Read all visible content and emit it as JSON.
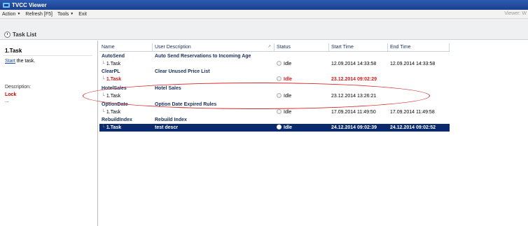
{
  "window": {
    "title": "TVCC Viewer"
  },
  "menu": [
    {
      "label": "Action",
      "has_caret": true
    },
    {
      "label": "Refresh [F5]",
      "has_caret": false
    },
    {
      "label": "Tools",
      "has_caret": true
    },
    {
      "label": "Exit",
      "has_caret": false
    }
  ],
  "viewer_label": "Viewer: W",
  "section_title": "Task List",
  "left_panel": {
    "task_name": "1.Task",
    "start_link": "Start",
    "start_rest": " the task.",
    "description_label": "Description:",
    "lock_label": "Lock",
    "ellipsis": "..."
  },
  "columns": [
    "Name",
    "User Description",
    "Status",
    "Start Time",
    "End Time"
  ],
  "rows": [
    {
      "type": "group",
      "name": "AutoSend",
      "description": "Auto Send Reservations to Incoming Age",
      "status": "",
      "start": "",
      "end": ""
    },
    {
      "type": "task",
      "name": "1.Task",
      "description": "",
      "status": "Idle",
      "start": "12.09.2014 14:33:58",
      "end": "12.09.2014 14:33:58"
    },
    {
      "type": "group",
      "name": "ClearPL",
      "description": "Clear Unused Price List",
      "status": "",
      "start": "",
      "end": ""
    },
    {
      "type": "task-red",
      "name": "1.Task",
      "description": "",
      "status": "Idle",
      "start": "23.12.2014 09:02:29",
      "end": ""
    },
    {
      "type": "group",
      "name": "HotelSales",
      "description": "Hotel Sales",
      "status": "",
      "start": "",
      "end": ""
    },
    {
      "type": "task",
      "name": "1.Task",
      "description": "",
      "status": "Idle",
      "start": "23.12.2014 13:26:21",
      "end": ""
    },
    {
      "type": "group",
      "name": "OptionDate",
      "description": "Option Date Expired Rules",
      "status": "",
      "start": "",
      "end": ""
    },
    {
      "type": "task",
      "name": "1.Task",
      "description": "",
      "status": "Idle",
      "start": "17.09.2014 11:49:50",
      "end": "17.09.2014 11:49:58"
    },
    {
      "type": "group",
      "name": "RebuildIndex",
      "description": "Rebuild Index",
      "status": "",
      "start": "",
      "end": ""
    },
    {
      "type": "task-selected",
      "name": "1.Task",
      "description": "test descr",
      "status": "Idle",
      "start": "24.12.2014 09:02:39",
      "end": "24.12.2014 09:02:52"
    }
  ],
  "colors": {
    "accent": "#0b2a6e",
    "alert": "#d81818",
    "annotation": "#d62a2a"
  }
}
